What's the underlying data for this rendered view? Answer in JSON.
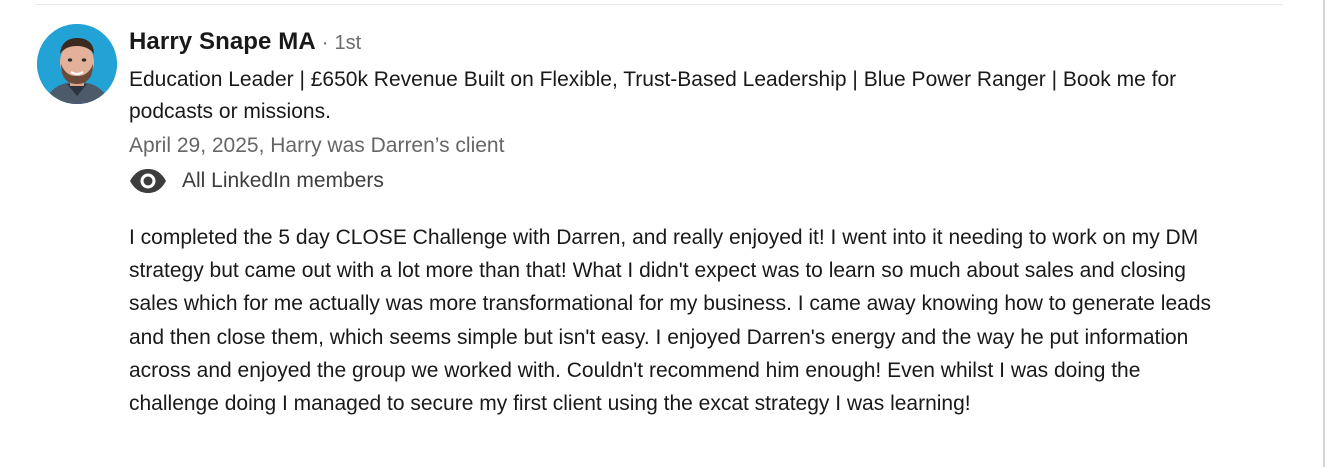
{
  "recommendation": {
    "author_name": "Harry Snape MA",
    "connection_separator": "·",
    "connection_degree": "1st",
    "headline": "Education Leader | £650k Revenue Built on Flexible, Trust-Based Leadership | Blue Power Ranger | Book me for podcasts or missions.",
    "date_relationship": "April 29, 2025, Harry was Darren’s client",
    "visibility_icon": "eye-icon",
    "visibility_label": "All LinkedIn members",
    "text": "I completed the 5 day CLOSE Challenge with Darren, and really enjoyed it! I went into it needing to work on my DM strategy but came out with a lot more than that! What I didn't expect was to learn so much about sales and closing sales which for me actually was more transformational for my business. I came away knowing how to generate leads and then close them, which seems simple but isn't easy. I enjoyed Darren's energy and the way he put information across and enjoyed the group we worked with. Couldn't recommend him enough! Even whilst I was doing the challenge doing I managed to secure my first client using the excat strategy I was learning!"
  },
  "colors": {
    "avatar_background": "#23a2d6",
    "primary_text": "#191919",
    "secondary_text": "#666666"
  }
}
